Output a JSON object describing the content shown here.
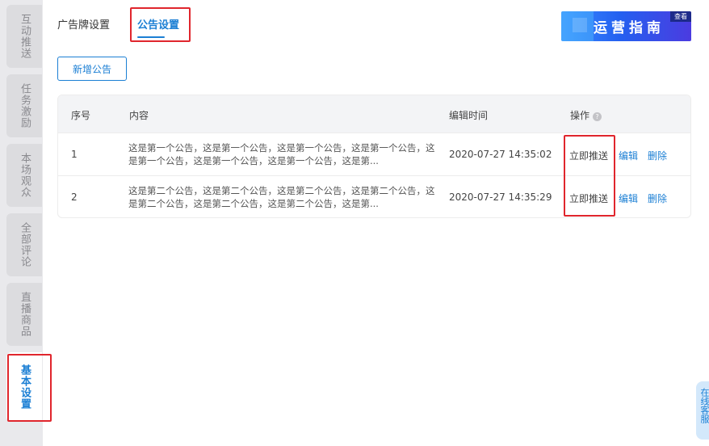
{
  "sidebar": {
    "items": [
      {
        "label": "互动推送",
        "active": false
      },
      {
        "label": "任务激励",
        "active": false
      },
      {
        "label": "本场观众",
        "active": false
      },
      {
        "label": "全部评论",
        "active": false
      },
      {
        "label": "直播商品",
        "active": false
      },
      {
        "label": "基本设置",
        "active": true
      }
    ]
  },
  "tabs": [
    {
      "label": "广告牌设置",
      "active": false
    },
    {
      "label": "公告设置",
      "active": true
    }
  ],
  "banner": {
    "text": "运营指南",
    "tag": "查看"
  },
  "add_button": "新增公告",
  "table": {
    "headers": [
      "序号",
      "内容",
      "编辑时间",
      "操作"
    ],
    "rows": [
      {
        "index": "1",
        "content": "这是第一个公告，这是第一个公告，这是第一个公告，这是第一个公告，这是第一个公告，这是第一个公告，这是第一个公告，这是第...",
        "time": "2020-07-27 14:35:02",
        "actions": [
          "立即推送",
          "编辑",
          "删除"
        ]
      },
      {
        "index": "2",
        "content": "这是第二个公告，这是第二个公告，这是第二个公告，这是第二个公告，这是第二个公告，这是第二个公告，这是第二个公告，这是第...",
        "time": "2020-07-27 14:35:29",
        "actions": [
          "立即推送",
          "编辑",
          "删除"
        ]
      }
    ]
  },
  "float_service": "在线客服",
  "colors": {
    "accent": "#1b7fd4",
    "highlight": "#e0262d"
  }
}
